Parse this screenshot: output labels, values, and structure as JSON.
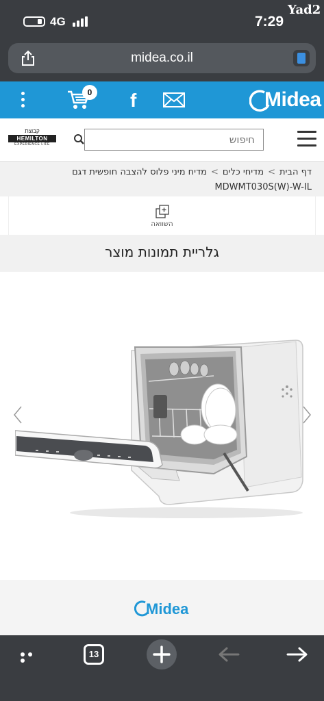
{
  "status_bar": {
    "network": "4G",
    "time": "7:29",
    "watermark": "Yad2"
  },
  "url_bar": {
    "domain": "midea.co.il"
  },
  "header": {
    "cart_count": "0",
    "facebook_glyph": "f",
    "brand_logo": "Midea",
    "accent_color": "#1f97d6"
  },
  "nav": {
    "partner_logo_top": "קבוצת",
    "partner_logo_name": "HEMILTON",
    "partner_logo_tagline": "EXPERIENCE LIFE",
    "search_placeholder": "חיפוש"
  },
  "breadcrumb": {
    "items": [
      "דף הבית",
      "מדיחי כלים",
      "מדיח מיני פלוס להצבה חופשית דגם"
    ],
    "separator": ">",
    "model": "MDWMT030S(W)-W-IL"
  },
  "compare": {
    "label": "השוואה"
  },
  "gallery": {
    "title": "גלריית תמונות מוצר",
    "image_subject": "mini dishwasher with open door"
  },
  "footer": {
    "brand_logo": "Midea"
  },
  "toolbar": {
    "tabs_count": "13"
  },
  "icons": [
    "share-icon",
    "reader-icon",
    "kebab-menu-icon",
    "cart-icon",
    "facebook-icon",
    "mail-icon",
    "search-icon",
    "hamburger-icon",
    "compare-icon",
    "chevron-left-icon",
    "chevron-right-icon",
    "more-icon",
    "plus-icon",
    "back-arrow-icon",
    "forward-arrow-icon"
  ]
}
